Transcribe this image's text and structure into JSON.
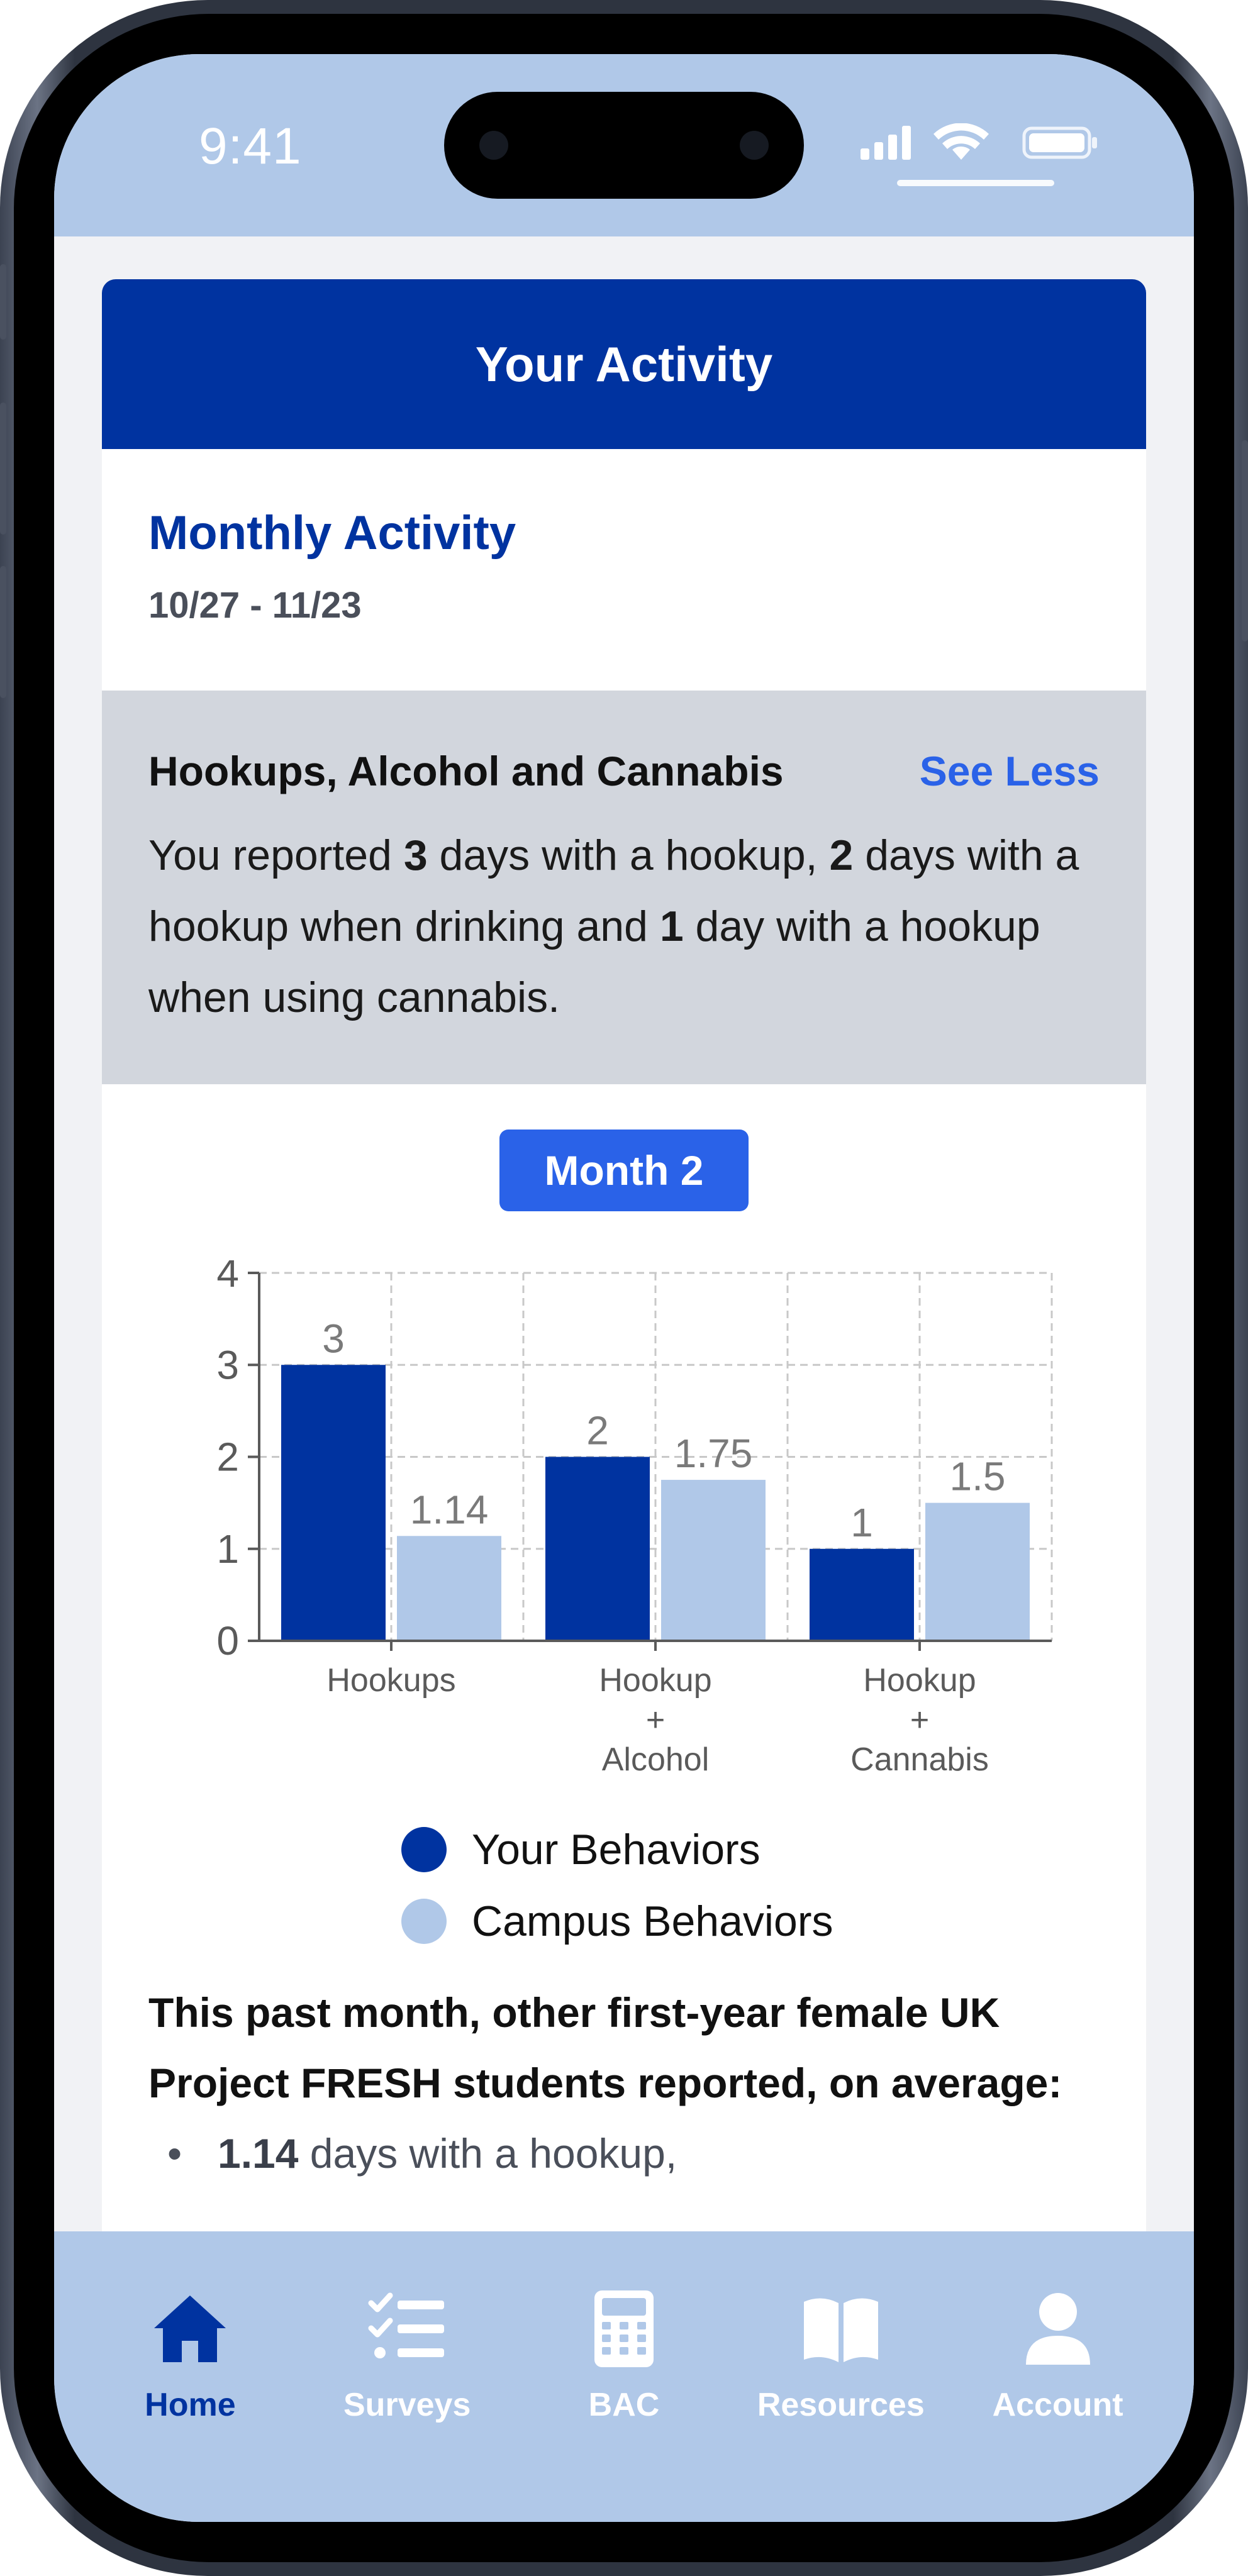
{
  "status_bar": {
    "time": "9:41"
  },
  "header": {
    "title": "Your Activity"
  },
  "section": {
    "title": "Monthly Activity",
    "date_range": "10/27 - 11/23"
  },
  "summary": {
    "heading": "Hookups, Alcohol and Cannabis",
    "toggle_label": "See Less",
    "text_parts": {
      "p1": "You reported ",
      "n1": "3",
      "p2": " days with a hookup, ",
      "n2": "2",
      "p3": " days with a hookup when drinking and ",
      "n3": "1",
      "p4": " day with a hookup when using cannabis."
    }
  },
  "month_pill": {
    "label": "Month 2"
  },
  "chart_data": {
    "type": "bar",
    "categories": [
      "Hookups",
      "Hookup + Alcohol",
      "Hookup + Cannabis"
    ],
    "category_lines": [
      [
        "Hookups"
      ],
      [
        "Hookup",
        "+",
        "Alcohol"
      ],
      [
        "Hookup",
        "+",
        "Cannabis"
      ]
    ],
    "series": [
      {
        "name": "Your Behaviors",
        "values": [
          3,
          2,
          1
        ],
        "labels": [
          "3",
          "2",
          "1"
        ],
        "color": "#0033a0"
      },
      {
        "name": "Campus Behaviors",
        "values": [
          1.14,
          1.75,
          1.5
        ],
        "labels": [
          "1.14",
          "1.75",
          "1.5"
        ],
        "color": "#b0c8e8"
      }
    ],
    "ylim": [
      0,
      4
    ],
    "yticks": [
      0,
      1,
      2,
      3,
      4
    ],
    "grid": true,
    "legend_position": "bottom"
  },
  "averages": {
    "heading": "This past month, other first-year female UK Project FRESH students reported, on average:",
    "items": [
      {
        "value": "1.14",
        "text": " days with a hookup,"
      }
    ]
  },
  "tab_bar": {
    "tabs": [
      {
        "label": "Home",
        "icon": "home-icon"
      },
      {
        "label": "Surveys",
        "icon": "checklist-icon"
      },
      {
        "label": "BAC",
        "icon": "calculator-icon"
      },
      {
        "label": "Resources",
        "icon": "book-icon"
      },
      {
        "label": "Account",
        "icon": "user-icon"
      }
    ]
  },
  "colors": {
    "primary": "#0033a0",
    "accent": "#2a62e8",
    "light": "#b0c8e8"
  }
}
